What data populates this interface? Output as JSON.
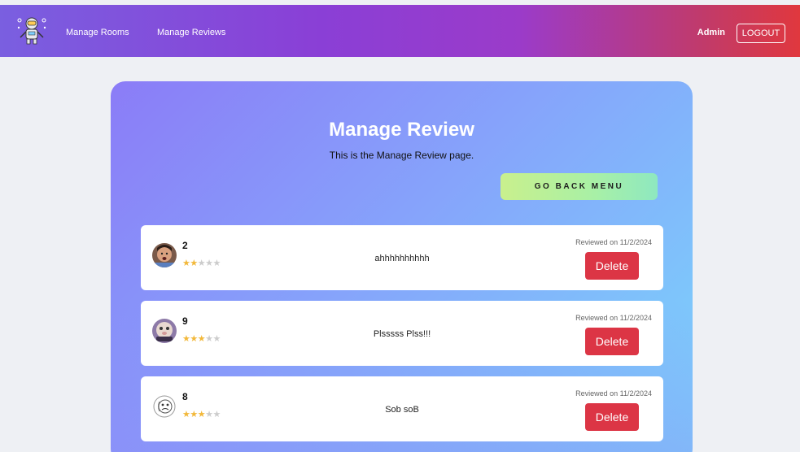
{
  "navbar": {
    "logo_icon": "robot-astronaut-icon",
    "links": [
      "Manage Rooms",
      "Manage Reviews"
    ],
    "user": "Admin",
    "logout_label": "LOGOUT"
  },
  "main": {
    "title": "Manage Review",
    "subtitle": "This is the Manage Review page.",
    "back_button": "GO BACK MENU"
  },
  "reviews": [
    {
      "rating_text": "2",
      "rating": 2,
      "comment": "ahhhhhhhhhh",
      "date": "Reviewed on 11/2/2024",
      "delete_label": "Delete"
    },
    {
      "rating_text": "9",
      "rating": 3,
      "comment": "Plsssss Plss!!!",
      "date": "Reviewed on 11/2/2024",
      "delete_label": "Delete"
    },
    {
      "rating_text": "8",
      "rating": 3,
      "comment": "Sob soB",
      "date": "Reviewed on 11/2/2024",
      "delete_label": "Delete"
    }
  ],
  "colors": {
    "delete": "#dc3545",
    "star_filled": "#f2b83a",
    "star_empty": "#cccccc"
  }
}
